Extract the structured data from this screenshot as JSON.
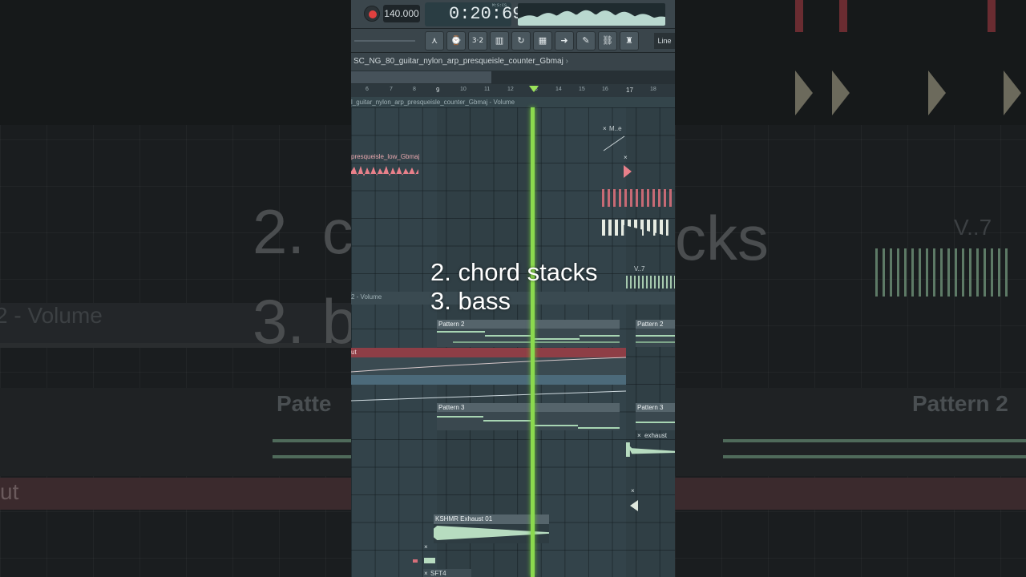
{
  "transport": {
    "tempo": "140.000",
    "time": "0:20:69",
    "time_format": "M:S:CS"
  },
  "toolbar": {
    "buttons": [
      "snap-icon",
      "metronome-icon",
      "countdown-icon",
      "step-icon",
      "loop-record-icon",
      "typing-keyboard-icon",
      "play-arrow-icon",
      "pencil-icon",
      "link-icon",
      "stamp-icon"
    ],
    "snap_mode": "Line"
  },
  "breadcrumb": {
    "path": "SC_NG_80_guitar_nylon_arp_presqueisle_counter_Gbmaj",
    "arrow": "›"
  },
  "ruler": {
    "bars": [
      "6",
      "7",
      "8",
      "9",
      "10",
      "11",
      "12",
      "13",
      "14",
      "15",
      "16",
      "17",
      "18"
    ]
  },
  "playlist": {
    "automation_lane_title": "l_guitar_nylon_arp_presqueisle_counter_Gbmaj - Volume",
    "audio_clip_1": "presqueisle_low_Gbmaj",
    "small_clip_top": "M..e",
    "volume_lane": "2 - Volume",
    "pattern_2": "Pattern 2",
    "pattern_2b": "Pattern 2",
    "pattern_3": "Pattern 3",
    "pattern_3b": "Pattern 3",
    "cut_label": "ut",
    "exhaust_clip": "exhaust",
    "kshmr_clip": "KSHMR Exhaust 01",
    "bottom_clip": "SFT4",
    "clip_close": "×",
    "v_label": "V..7"
  },
  "overlay": {
    "line1": "2. chord stacks",
    "line2": "3. bass"
  },
  "background": {
    "big_left": [
      "2. c",
      "3. b"
    ],
    "big_right": "cks",
    "volume_left": "2 - Volume",
    "pattern_left": "Patte",
    "pattern_right": "Pattern 2",
    "ut_left": "ut",
    "v_right": "V..7"
  },
  "colors": {
    "playhead": "#8bd94e",
    "pattern_note": "#a8d5b3",
    "audio_red": "#e8808a",
    "automation_red": "#8e3e46",
    "automation_blue": "#4c6a7a"
  }
}
